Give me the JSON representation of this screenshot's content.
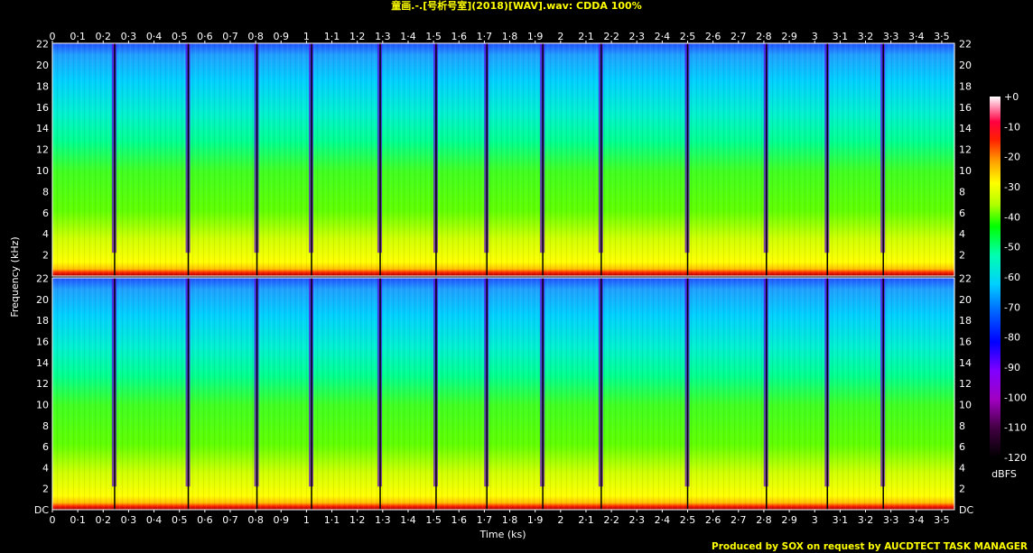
{
  "title": "童画.-.[号析号室](2018)[WAV].wav: CDDA 100%",
  "credit": "Produced by SOX on request by AUCDTECT TASK MANAGER",
  "chart_data": {
    "type": "heatmap",
    "title": "童画.-.[号析号室](2018)[WAV].wav: CDDA 100%",
    "xlabel": "Time (ks)",
    "ylabel": "Frequency (kHz)",
    "colorbar_label": "dBFS",
    "xlim": [
      0,
      3.55
    ],
    "ylim": [
      0,
      22.05
    ],
    "channels": 2,
    "x_ticks": [
      "0",
      "0·1",
      "0·2",
      "0·3",
      "0·4",
      "0·5",
      "0·6",
      "0·7",
      "0·8",
      "0·9",
      "1",
      "1·1",
      "1·2",
      "1·3",
      "1·4",
      "1·5",
      "1·6",
      "1·7",
      "1·8",
      "1·9",
      "2",
      "2·1",
      "2·2",
      "2·3",
      "2·4",
      "2·5",
      "2·6",
      "2·7",
      "2·8",
      "2·9",
      "3",
      "3·1",
      "3·2",
      "3·3",
      "3·4",
      "3·5"
    ],
    "y_ticks": [
      "DC",
      "2",
      "4",
      "6",
      "8",
      "10",
      "12",
      "14",
      "16",
      "18",
      "20",
      "22"
    ],
    "colorbar_ticks": [
      "+0",
      "-10",
      "-20",
      "-30",
      "-40",
      "-50",
      "-60",
      "-70",
      "-80",
      "-90",
      "-100",
      "-110",
      "-120"
    ],
    "colorbar_range": [
      -120,
      0
    ],
    "track_boundaries_ks": [
      0.245,
      0.535,
      0.805,
      1.02,
      1.29,
      1.51,
      1.71,
      1.93,
      2.16,
      2.5,
      2.81,
      3.05,
      3.27
    ],
    "colors": {
      "background": "#000000",
      "axis": "#ffffff",
      "title": "#ffff00",
      "colormap": [
        "#000000",
        "#400040",
        "#8000a0",
        "#c000ff",
        "#6000ff",
        "#0000ff",
        "#0080ff",
        "#00e0ff",
        "#00ffc0",
        "#00ff00",
        "#c0ff00",
        "#ffff00",
        "#ffa000",
        "#ff3000",
        "#ff0000",
        "#ff80a0",
        "#ffffff"
      ]
    }
  }
}
